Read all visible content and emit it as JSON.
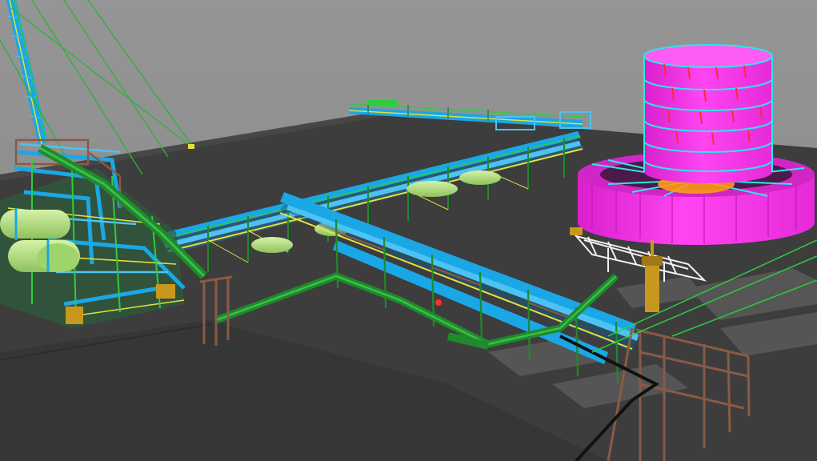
{
  "scene": {
    "colors": {
      "sky": "#8c8c8c",
      "ground": "#3f3f3f",
      "ground_dark": "#333333",
      "pipe_blue": "#1aa7e6",
      "pipe_blue_light": "#4cc3f2",
      "pipe_green": "#1f8a2a",
      "pipe_green_light": "#39c04a",
      "vessel_green": "#b9e68a",
      "steel_yellow": "#e2e23a",
      "steel_brown": "#8a5a44",
      "tank_magenta": "#ff3df0",
      "tank_magenta_dark": "#c21bb6",
      "tank_cyan": "#2fe6e6",
      "tank_red": "#ff2a3a",
      "tank_orange": "#ff9a1a",
      "equipment_gold": "#c8981e",
      "stair_white": "#f2f2f2",
      "cable_green": "#2ecc40",
      "concrete_gray": "#6e6e6e"
    },
    "objects": [
      {
        "name": "flare-stack"
      },
      {
        "name": "guy-wire"
      },
      {
        "name": "plant-deck"
      },
      {
        "name": "process-module-left"
      },
      {
        "name": "horizontal-vessel"
      },
      {
        "name": "pipe-rack-main"
      },
      {
        "name": "pipe-rack-far"
      },
      {
        "name": "pipe-rack-front"
      },
      {
        "name": "green-pipeline"
      },
      {
        "name": "storage-tank"
      },
      {
        "name": "platform-stairway"
      },
      {
        "name": "equipment-skid"
      },
      {
        "name": "support-frame-front"
      }
    ]
  }
}
